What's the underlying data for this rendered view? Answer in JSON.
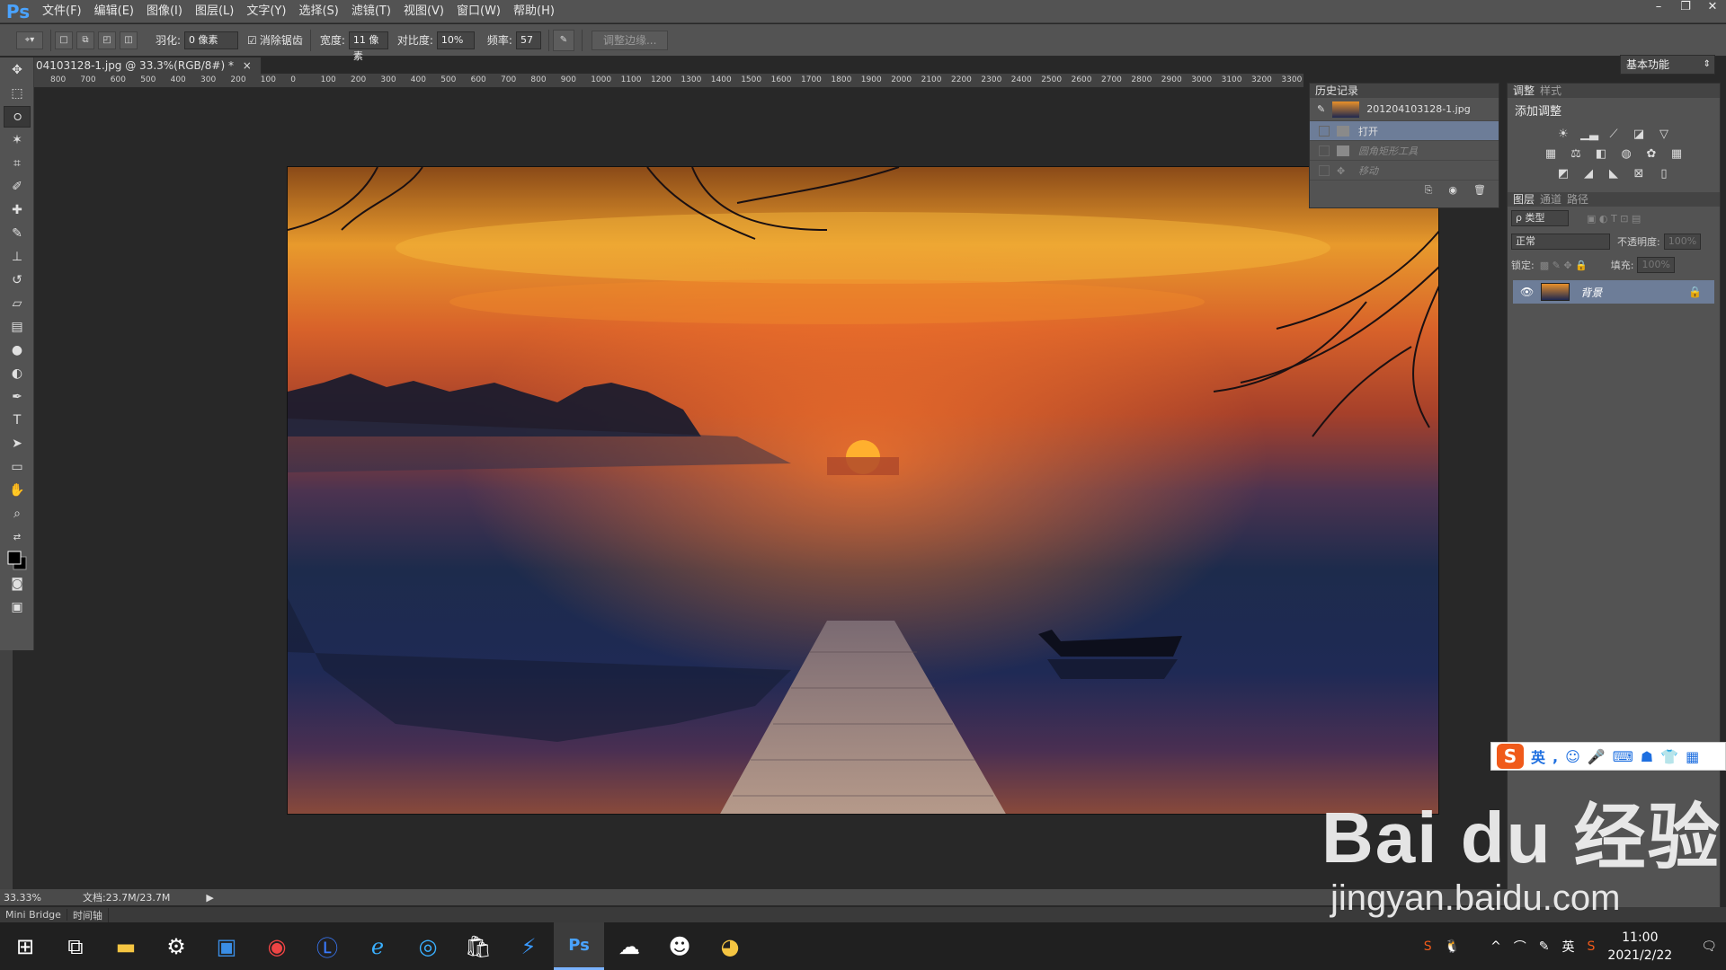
{
  "app": {
    "logo": "Ps"
  },
  "menu": [
    "文件(F)",
    "编辑(E)",
    "图像(I)",
    "图层(L)",
    "文字(Y)",
    "选择(S)",
    "滤镜(T)",
    "视图(V)",
    "窗口(W)",
    "帮助(H)"
  ],
  "window_controls": [
    "–",
    "❐",
    "✕"
  ],
  "options": {
    "feather_label": "羽化:",
    "feather_value": "0 像素",
    "antialias_label": "消除锯齿",
    "width_label": "宽度:",
    "width_value": "11 像素",
    "contrast_label": "对比度:",
    "contrast_value": "10%",
    "frequency_label": "频率:",
    "frequency_value": "57",
    "refine_button": "调整边缘...",
    "workspace": "基本功能"
  },
  "document": {
    "tab_label": "04103128-1.jpg @ 33.3%(RGB/8#) *",
    "close": "×"
  },
  "ruler_ticks": [
    "800",
    "700",
    "600",
    "500",
    "400",
    "300",
    "200",
    "100",
    "0",
    "100",
    "200",
    "300",
    "400",
    "500",
    "600",
    "700",
    "800",
    "900",
    "1000",
    "1100",
    "1200",
    "1300",
    "1400",
    "1500",
    "1600",
    "1700",
    "1800",
    "1900",
    "2000",
    "2100",
    "2200",
    "2300",
    "2400",
    "2500",
    "2600",
    "2700",
    "2800",
    "2900",
    "3000",
    "3100",
    "3200",
    "3300"
  ],
  "status": {
    "zoom": "33.33%",
    "doc": "文档:23.7M/23.7M"
  },
  "bottom_tabs": [
    "Mini Bridge",
    "时间轴"
  ],
  "history": {
    "title": "历史记录",
    "snapshot": "201204103128-1.jpg",
    "items": [
      {
        "label": "打开",
        "state": "selected"
      },
      {
        "label": "圆角矩形工具",
        "state": "dim"
      },
      {
        "label": "移动",
        "state": "dim"
      }
    ]
  },
  "adjust": {
    "tabs": [
      "调整",
      "样式"
    ],
    "title": "添加调整"
  },
  "layers": {
    "tabs": [
      "图层",
      "通道",
      "路径"
    ],
    "filter": "ρ 类型",
    "blend": "正常",
    "opacity_label": "不透明度:",
    "opacity_value": "100%",
    "lock_label": "锁定:",
    "fill_label": "填充:",
    "fill_value": "100%",
    "layer_name": "背景"
  },
  "ime": {
    "logo": "S",
    "lang": "英"
  },
  "watermark": {
    "line1": "Bai du 经验",
    "line2": "jingyan.baidu.com"
  },
  "tray": {
    "lang": "英",
    "time": "11:00",
    "date": "2021/2/22"
  }
}
